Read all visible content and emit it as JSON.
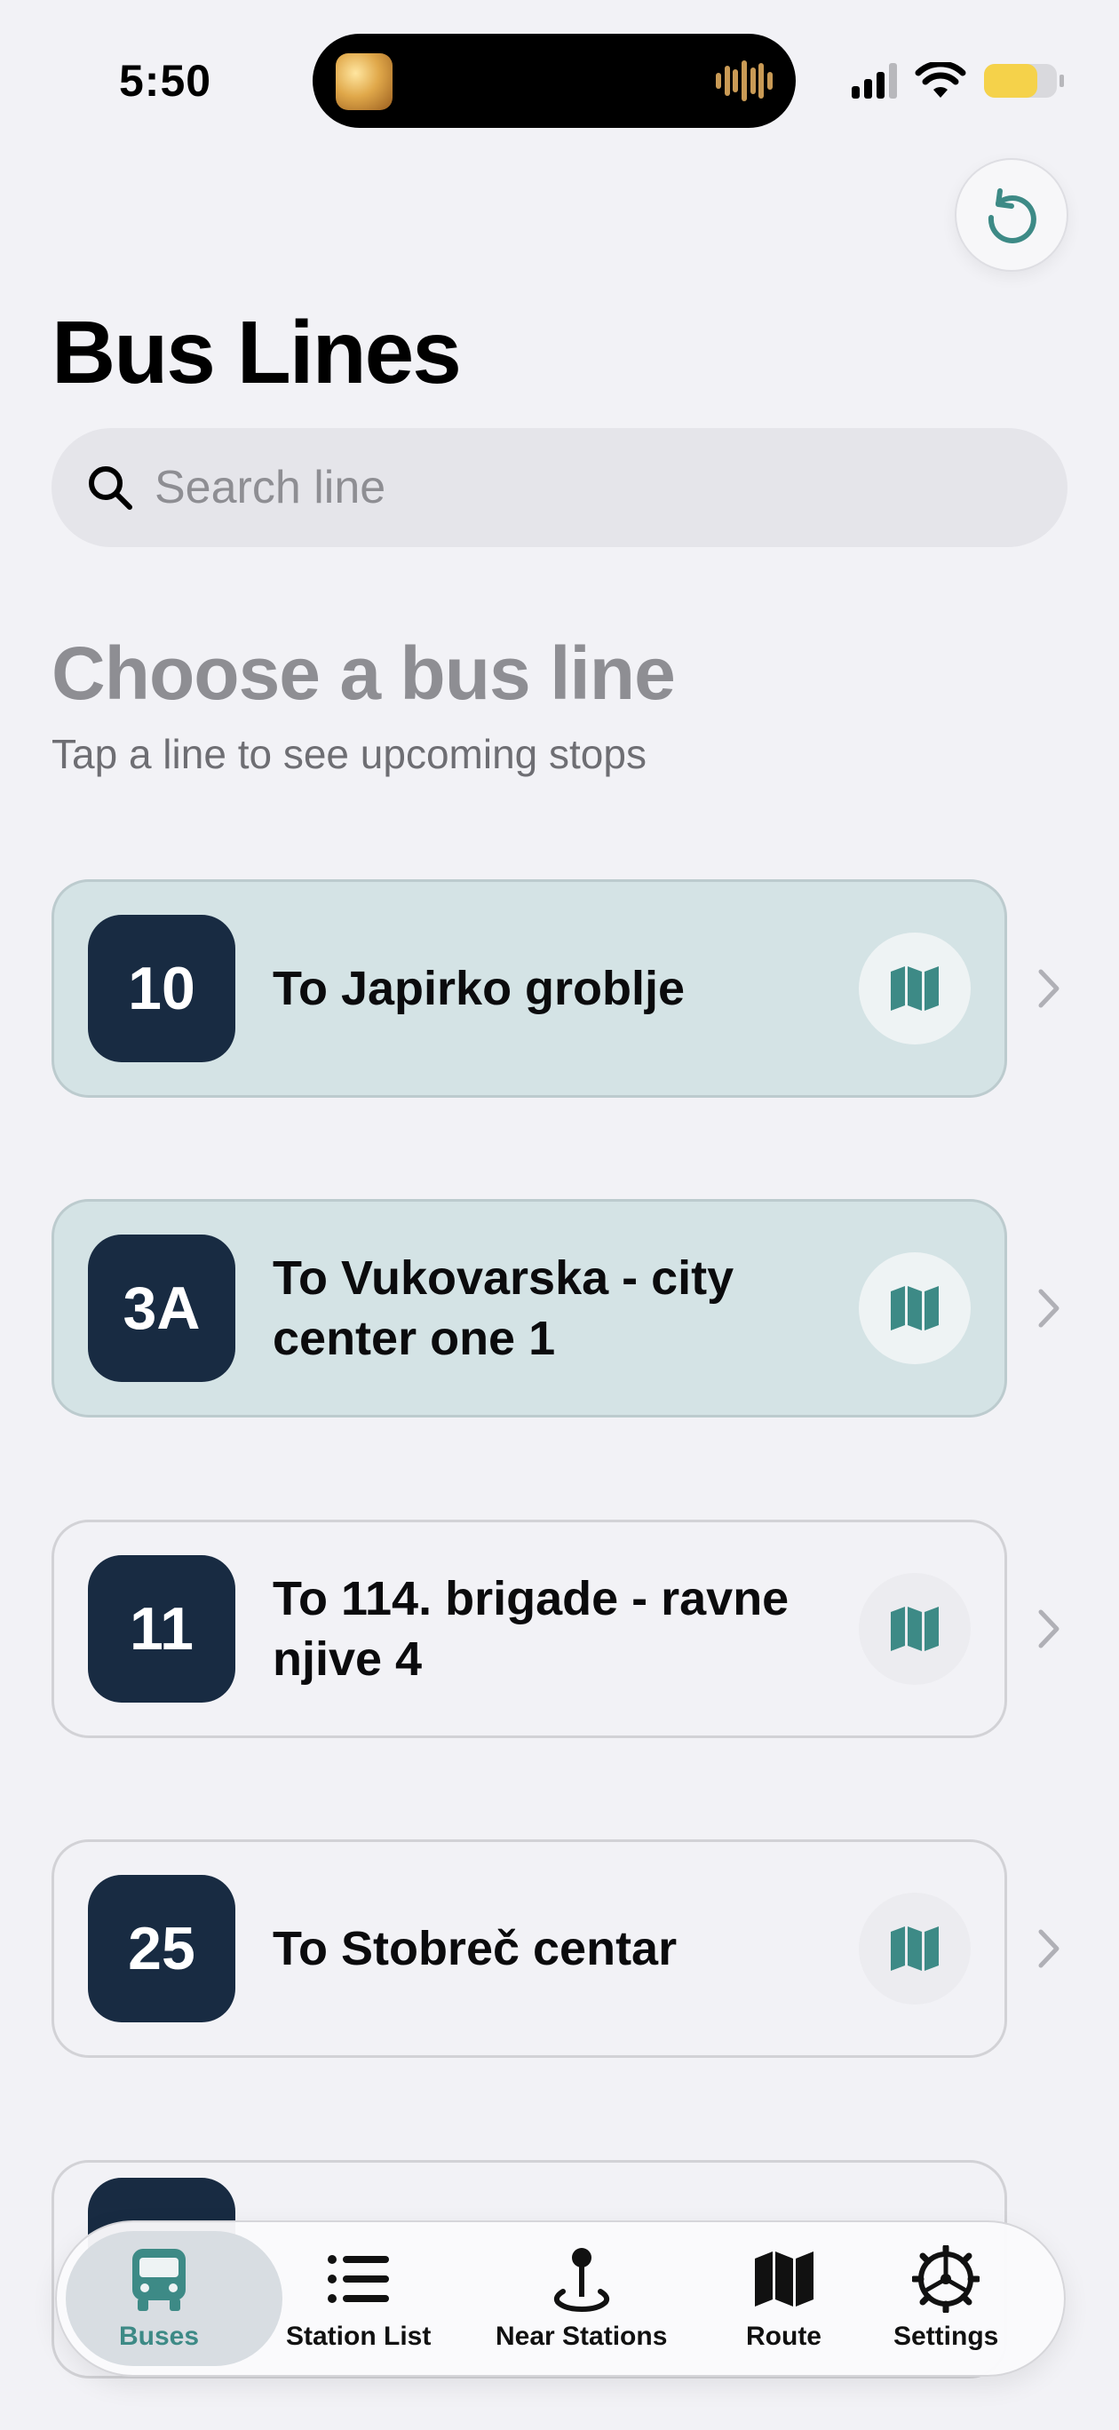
{
  "status_bar": {
    "time": "5:50"
  },
  "colors": {
    "accent": "#3d8a86",
    "badge": "#182b42",
    "highlight_card": "#d4e3e5",
    "background": "#f2f2f6"
  },
  "header": {
    "title": "Bus Lines",
    "refresh_icon": "refresh-icon"
  },
  "search": {
    "placeholder": "Search line",
    "value": ""
  },
  "section": {
    "title": "Choose a bus line",
    "subtitle": "Tap a line to see upcoming stops"
  },
  "lines": [
    {
      "number": "10",
      "label": "To Japirko groblje",
      "highlighted": true
    },
    {
      "number": "3A",
      "label": "To Vukovarska - city center one 1",
      "highlighted": true
    },
    {
      "number": "11",
      "label": "To 114. brigade - ravne njive 4",
      "highlighted": false
    },
    {
      "number": "25",
      "label": "To Stobreč centar",
      "highlighted": false
    }
  ],
  "tabbar": {
    "tabs": [
      {
        "label": "Buses",
        "icon": "bus-icon",
        "active": true
      },
      {
        "label": "Station List",
        "icon": "list-icon",
        "active": false
      },
      {
        "label": "Near Stations",
        "icon": "location-pin-icon",
        "active": false
      },
      {
        "label": "Route",
        "icon": "map-icon",
        "active": false
      },
      {
        "label": "Settings",
        "icon": "gear-icon",
        "active": false
      }
    ]
  }
}
